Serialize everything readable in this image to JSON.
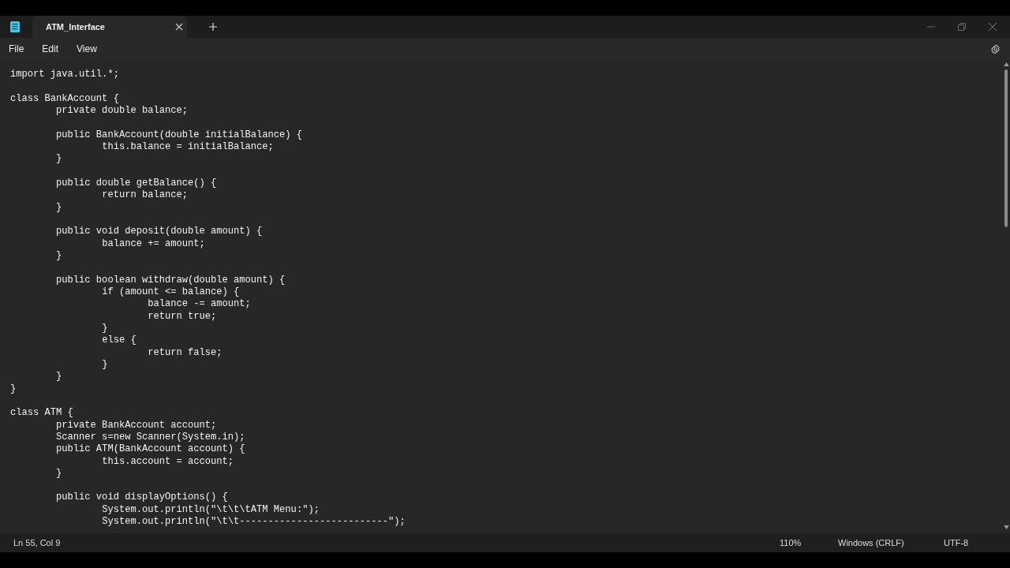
{
  "tabs": [
    {
      "title": "ATM_Interface",
      "selected": true
    }
  ],
  "menu": [
    "File",
    "Edit",
    "View"
  ],
  "code_blocks": [
    [
      "import java.util.*;"
    ],
    [
      "class BankAccount {",
      "\tprivate double balance;"
    ],
    [
      "\tpublic BankAccount(double initialBalance) {",
      "\t\tthis.balance = initialBalance;",
      "\t}"
    ],
    [
      "\tpublic double getBalance() {",
      "\t\treturn balance;",
      "\t}"
    ],
    [
      "\tpublic void deposit(double amount) {",
      "\t\tbalance += amount;",
      "\t}"
    ],
    [
      "\tpublic boolean withdraw(double amount) {",
      "\t\tif (amount <= balance) {",
      "\t\t\tbalance -= amount;",
      "\t\t\treturn true;",
      "\t\t}",
      "\t\telse {",
      "\t\t\treturn false;",
      "\t\t}",
      "\t}",
      "}"
    ],
    [
      "class ATM {",
      "\tprivate BankAccount account;",
      "\tScanner s=new Scanner(System.in);",
      "\tpublic ATM(BankAccount account) {",
      "\t\tthis.account = account;",
      "\t}"
    ],
    [
      "\tpublic void displayOptions() {",
      "\t\tSystem.out.println(\"\\t\\t\\tATM Menu:\");",
      "\t\tSystem.out.println(\"\\t\\t--------------------------\");"
    ]
  ],
  "status_bar": {
    "position": "Ln 55, Col 9",
    "zoom": "110%",
    "line_ending": "Windows (CRLF)",
    "encoding": "UTF-8"
  }
}
